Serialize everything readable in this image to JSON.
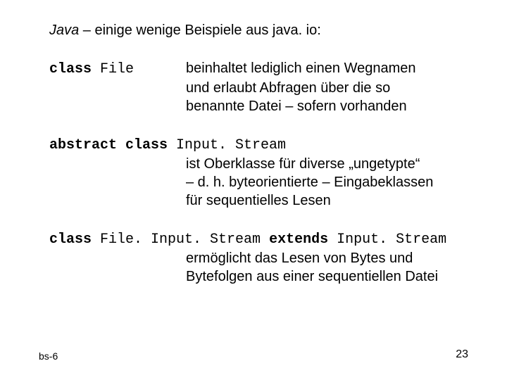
{
  "title": {
    "java": "Java",
    "rest": " –  einige wenige Beispiele aus java. io:"
  },
  "block1": {
    "kw": "class ",
    "cls": "File",
    "desc_l1": "beinhaltet lediglich einen Wegnamen",
    "desc_l2": "und erlaubt Abfragen über die so",
    "desc_l3": "benannte Datei – sofern vorhanden"
  },
  "block2": {
    "kw": "abstract class ",
    "cls": "Input. Stream",
    "desc_l1": "ist Oberklasse für diverse „ungetypte“",
    "desc_l2": "–  d. h. byteorientierte – Eingabeklassen",
    "desc_l3": "für sequentielles Lesen"
  },
  "block3": {
    "kw1": "class ",
    "cls1": "File. Input. Stream",
    "kw2": " extends ",
    "cls2": "Input. Stream",
    "desc_l1": "ermöglicht das Lesen von Bytes und",
    "desc_l2": "Bytefolgen aus einer sequentiellen Datei"
  },
  "footer": {
    "left": "bs-6",
    "right": "23"
  }
}
